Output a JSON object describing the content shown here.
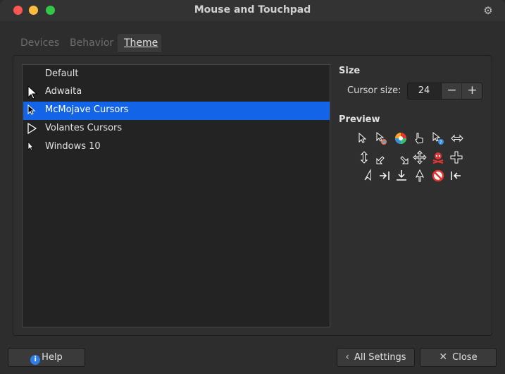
{
  "window": {
    "title": "Mouse and Touchpad"
  },
  "tabs": [
    {
      "label": "Devices",
      "active": false
    },
    {
      "label": "Behavior",
      "active": false
    },
    {
      "label": "Theme",
      "active": true
    }
  ],
  "themes": [
    {
      "label": "Default",
      "icon": "none",
      "selected": false
    },
    {
      "label": "Adwaita",
      "icon": "arrow-cursor-icon",
      "selected": false
    },
    {
      "label": "McMojave Cursors",
      "icon": "arrow-cursor-icon",
      "selected": true
    },
    {
      "label": "Volantes Cursors",
      "icon": "arrow-cursor-icon",
      "selected": false
    },
    {
      "label": "Windows 10",
      "icon": "arrow-cursor-icon",
      "selected": false
    }
  ],
  "size": {
    "heading": "Size",
    "cursor_size_label": "Cursor size:",
    "cursor_size_value": "24",
    "minus_label": "−",
    "plus_label": "+"
  },
  "preview": {
    "heading": "Preview",
    "icons": [
      "arrow-cursor-icon",
      "progress-cursor-icon",
      "wait-spinner-icon",
      "hand-pointer-icon",
      "help-cursor-icon",
      "resize-horizontal-icon",
      "resize-vertical-icon",
      "resize-diagonal-icon",
      "resize-diagonal-alt-icon",
      "move-cursor-icon",
      "pirate-cursor-icon",
      "crosshair-icon",
      "up-arrow-icon",
      "resize-right-icon",
      "resize-bottom-icon",
      "up-arrow-outline-icon",
      "not-allowed-icon",
      "resize-left-icon"
    ]
  },
  "buttons": {
    "help": "Help",
    "all_settings": "All Settings",
    "close": "Close"
  },
  "colors": {
    "selection": "#1364e6",
    "close_red": "#fc5753",
    "minimize_yellow": "#fdbc40",
    "maximize_green": "#33c748"
  }
}
